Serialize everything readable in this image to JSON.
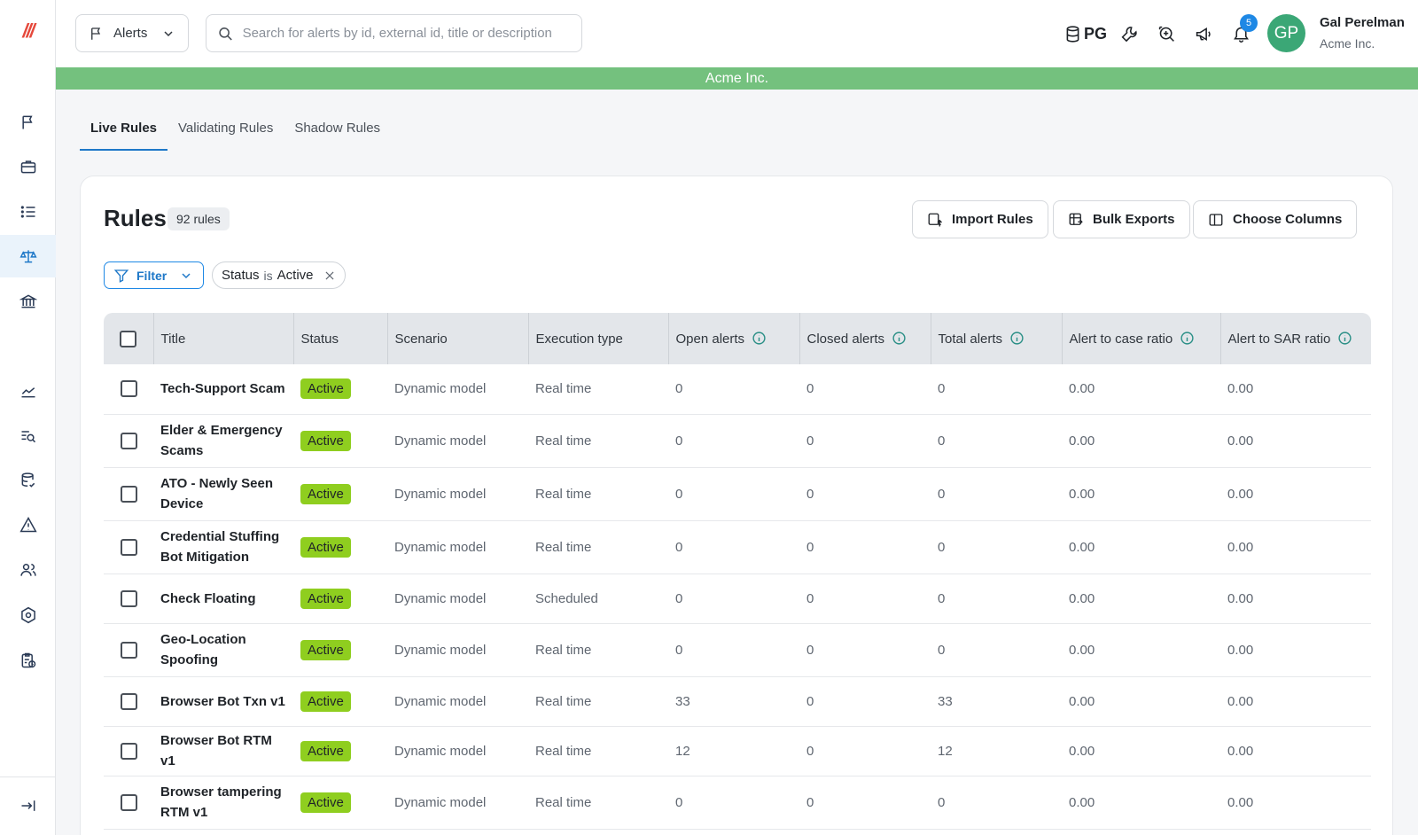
{
  "app": {
    "logo_text": "///"
  },
  "topbar": {
    "module_label": "Alerts",
    "search_placeholder": "Search for alerts by id, external id, title or description",
    "db_label": "PG",
    "notification_count": "5",
    "avatar_initials": "GP",
    "user_name": "Gal Perelman",
    "user_org": "Acme Inc."
  },
  "org_banner": "Acme Inc.",
  "tabs": [
    {
      "label": "Live Rules"
    },
    {
      "label": "Validating Rules"
    },
    {
      "label": "Shadow Rules"
    }
  ],
  "rules": {
    "title": "Rules",
    "count": "92 rules",
    "import_label": "Import Rules",
    "bulk_export_label": "Bulk Exports",
    "choose_columns_label": "Choose Columns",
    "filter_label": "Filter",
    "chip": {
      "field": "Status",
      "op": "is",
      "value": "Active"
    }
  },
  "table": {
    "columns": [
      "Title",
      "Status",
      "Scenario",
      "Execution type",
      "Open alerts",
      "Closed alerts",
      "Total alerts",
      "Alert to case ratio",
      "Alert to SAR ratio"
    ],
    "rows": [
      {
        "title": "Tech-Support Scam",
        "status": "Active",
        "scenario": "Dynamic model",
        "exec": "Real time",
        "open": "0",
        "closed": "0",
        "total": "0",
        "case_ratio": "0.00",
        "sar_ratio": "0.00"
      },
      {
        "title": "Elder & Emergency Scams",
        "status": "Active",
        "scenario": "Dynamic model",
        "exec": "Real time",
        "open": "0",
        "closed": "0",
        "total": "0",
        "case_ratio": "0.00",
        "sar_ratio": "0.00"
      },
      {
        "title": "ATO - Newly Seen Device",
        "status": "Active",
        "scenario": "Dynamic model",
        "exec": "Real time",
        "open": "0",
        "closed": "0",
        "total": "0",
        "case_ratio": "0.00",
        "sar_ratio": "0.00"
      },
      {
        "title": "Credential Stuffing Bot Mitigation",
        "status": "Active",
        "scenario": "Dynamic model",
        "exec": "Real time",
        "open": "0",
        "closed": "0",
        "total": "0",
        "case_ratio": "0.00",
        "sar_ratio": "0.00"
      },
      {
        "title": "Check Floating",
        "status": "Active",
        "scenario": "Dynamic model",
        "exec": "Scheduled",
        "open": "0",
        "closed": "0",
        "total": "0",
        "case_ratio": "0.00",
        "sar_ratio": "0.00"
      },
      {
        "title": "Geo-Location Spoofing",
        "status": "Active",
        "scenario": "Dynamic model",
        "exec": "Real time",
        "open": "0",
        "closed": "0",
        "total": "0",
        "case_ratio": "0.00",
        "sar_ratio": "0.00"
      },
      {
        "title": "Browser Bot Txn v1",
        "status": "Active",
        "scenario": "Dynamic model",
        "exec": "Real time",
        "open": "33",
        "closed": "0",
        "total": "33",
        "case_ratio": "0.00",
        "sar_ratio": "0.00"
      },
      {
        "title": "Browser Bot RTM v1",
        "status": "Active",
        "scenario": "Dynamic model",
        "exec": "Real time",
        "open": "12",
        "closed": "0",
        "total": "12",
        "case_ratio": "0.00",
        "sar_ratio": "0.00"
      },
      {
        "title": "Browser tampering RTM v1",
        "status": "Active",
        "scenario": "Dynamic model",
        "exec": "Real time",
        "open": "0",
        "closed": "0",
        "total": "0",
        "case_ratio": "0.00",
        "sar_ratio": "0.00"
      }
    ]
  },
  "colors": {
    "accent": "#1e78c8",
    "banner": "#74c17e",
    "status_active": "#8fce1f",
    "avatar": "#3ba776"
  }
}
